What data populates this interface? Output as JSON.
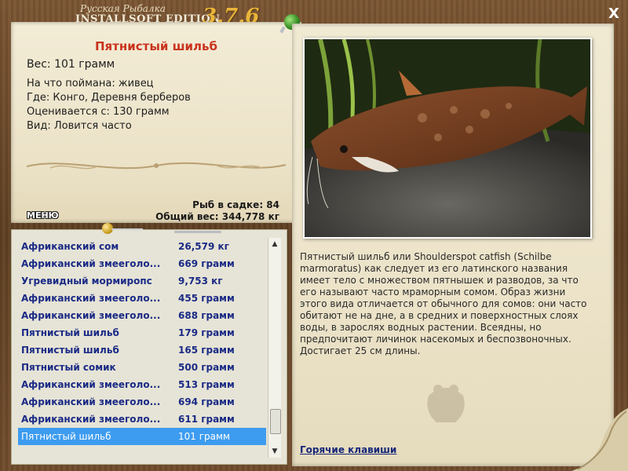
{
  "window": {
    "brand_small": "Русская Рыбалка",
    "brand_big": "INSTALLSOFT EDITION",
    "version": "3.7.6",
    "close_label": "X"
  },
  "fish": {
    "name": "Пятнистый шильб",
    "weight": "Вес: 101 грамм",
    "caught_on": "На что поймана: живец",
    "where": "Где: Конго, Деревня берберов",
    "valued_from": "Оценивается с: 130 грамм",
    "kind": "Вид: Ловится часто"
  },
  "stats": {
    "fish_in_keepnet": "Рыб в садке: 84",
    "total_weight": "Общий вес: 344,778 кг"
  },
  "menu_label": "МЕНЮ",
  "list": {
    "rows": [
      {
        "name": "Африканский сом",
        "weight": "26,579 кг",
        "selected": false
      },
      {
        "name": "Африканский змееголо...",
        "weight": "669 грамм",
        "selected": false
      },
      {
        "name": "Угревидный мормиропс",
        "weight": "9,753 кг",
        "selected": false
      },
      {
        "name": "Африканский змееголо...",
        "weight": "455 грамм",
        "selected": false
      },
      {
        "name": "Африканский змееголо...",
        "weight": "688 грамм",
        "selected": false
      },
      {
        "name": "Пятнистый шильб",
        "weight": "179 грамм",
        "selected": false
      },
      {
        "name": "Пятнистый шильб",
        "weight": "165 грамм",
        "selected": false
      },
      {
        "name": "Пятнистый сомик",
        "weight": "500 грамм",
        "selected": false
      },
      {
        "name": "Африканский змееголо...",
        "weight": "513 грамм",
        "selected": false
      },
      {
        "name": "Африканский змееголо...",
        "weight": "694 грамм",
        "selected": false
      },
      {
        "name": "Африканский змееголо...",
        "weight": "611 грамм",
        "selected": false
      },
      {
        "name": "Пятнистый шильб",
        "weight": "101 грамм",
        "selected": true
      }
    ],
    "selected_color": "#3d9cf0"
  },
  "description": "Пятнистый шильб или Shoulderspot catfish (Schilbe marmoratus) как следует из его латинского названия имеет тело с множеством пятнышек и разводов, за что его называют часто мраморным сомом. Образ жизни этого вида отличается от обычного для сомов: они часто обитают не на дне, а в средних и поверхностных слоях воды, в зарослях водных растении. Всеядны, но предпочитают личинок насекомых и беспозвоночных. Достигает 25 см длины.",
  "hotkeys_label": "Горячие клавиши",
  "colors": {
    "fish_name": "#c9331c",
    "list_text": "#1a2a86",
    "version": "#e9b53a"
  }
}
